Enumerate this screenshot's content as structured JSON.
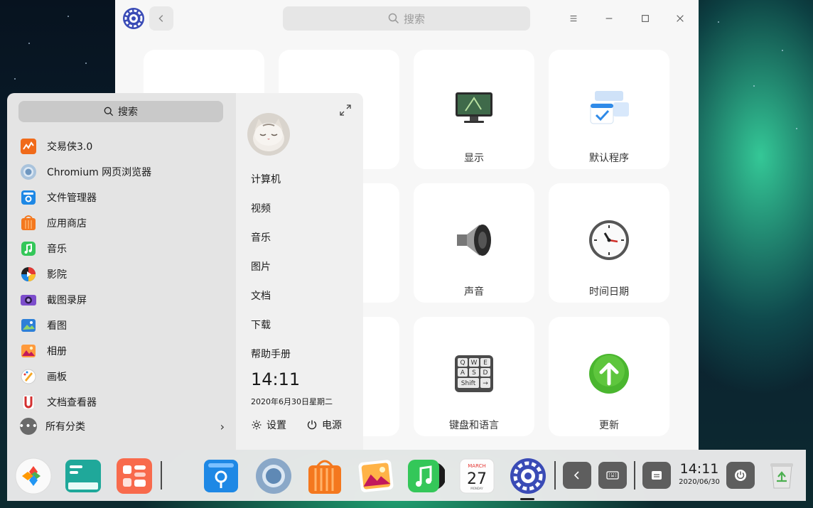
{
  "control_center": {
    "search_placeholder": "搜索",
    "tiles": [
      {
        "label": "显示",
        "icon": "monitor-icon"
      },
      {
        "label": "默认程序",
        "icon": "default-apps-icon"
      },
      {
        "label": "声音",
        "icon": "speaker-icon"
      },
      {
        "label": "时间日期",
        "icon": "clock-icon"
      },
      {
        "label": "键盘和语言",
        "icon": "keyboard-icon"
      },
      {
        "label": "更新",
        "icon": "update-arrow-icon"
      }
    ]
  },
  "launcher": {
    "search_label": "搜索",
    "apps": [
      {
        "label": "交易侠3.0",
        "icon": "trading-icon",
        "color": "#f06a1a"
      },
      {
        "label": "Chromium 网页浏览器",
        "icon": "chromium-icon",
        "color": "#9ab8d6"
      },
      {
        "label": "文件管理器",
        "icon": "file-manager-icon",
        "color": "#1e88e5"
      },
      {
        "label": "应用商店",
        "icon": "app-store-icon",
        "color": "#f4781e"
      },
      {
        "label": "音乐",
        "icon": "music-icon",
        "color": "#34c759"
      },
      {
        "label": "影院",
        "icon": "movie-icon",
        "color": "#222222"
      },
      {
        "label": "截图录屏",
        "icon": "screenshot-icon",
        "color": "#6a3fb5"
      },
      {
        "label": "看图",
        "icon": "image-viewer-icon",
        "color": "#2d7fd8"
      },
      {
        "label": "相册",
        "icon": "album-icon",
        "color": "#ff9a3c"
      },
      {
        "label": "画板",
        "icon": "draw-icon",
        "color": "#f5a623"
      },
      {
        "label": "文档查看器",
        "icon": "document-viewer-icon",
        "color": "#d32f2f"
      }
    ],
    "all_categories_label": "所有分类",
    "directories": [
      "计算机",
      "视频",
      "音乐",
      "图片",
      "文档",
      "下载",
      "帮助手册"
    ],
    "clock_time": "14:11",
    "clock_date": "2020年6月30日星期二",
    "settings_label": "设置",
    "power_label": "电源"
  },
  "dock": {
    "apps": [
      {
        "name": "launcher-icon"
      },
      {
        "name": "multitasking-view-icon"
      },
      {
        "name": "desktop-widgets-icon"
      },
      {
        "name": "file-manager-icon"
      },
      {
        "name": "chromium-icon"
      },
      {
        "name": "app-store-icon"
      },
      {
        "name": "album-icon"
      },
      {
        "name": "music-icon"
      },
      {
        "name": "calendar-icon"
      },
      {
        "name": "control-center-icon"
      }
    ],
    "calendar": {
      "month": "MARCH",
      "day": "27",
      "weekday": "MONDAY"
    },
    "time": "14:11",
    "date": "2020/06/30"
  }
}
